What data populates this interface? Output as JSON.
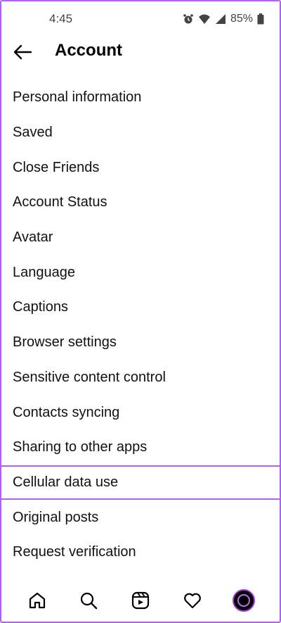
{
  "status_bar": {
    "time": "4:45",
    "battery": "85%",
    "icons": [
      "alarm-icon",
      "wifi-icon",
      "signal-icon",
      "battery-icon"
    ]
  },
  "header": {
    "title": "Account",
    "back_icon": "back-arrow-icon"
  },
  "menu": {
    "items": [
      {
        "label": "Personal information"
      },
      {
        "label": "Saved"
      },
      {
        "label": "Close Friends"
      },
      {
        "label": "Account Status"
      },
      {
        "label": "Avatar"
      },
      {
        "label": "Language"
      },
      {
        "label": "Captions"
      },
      {
        "label": "Browser settings"
      },
      {
        "label": "Sensitive content control"
      },
      {
        "label": "Contacts syncing"
      },
      {
        "label": "Sharing to other apps"
      },
      {
        "label": "Cellular data use"
      },
      {
        "label": "Original posts"
      },
      {
        "label": "Request verification"
      }
    ],
    "highlighted_item": "Cellular data use"
  },
  "bottom_nav": {
    "items": [
      "home-icon",
      "search-icon",
      "reels-icon",
      "heart-icon",
      "profile-avatar"
    ]
  },
  "colors": {
    "highlight_border": "#b65ff0",
    "text": "#111111",
    "status_text": "#444444",
    "avatar_accent": "#a23bd9"
  }
}
